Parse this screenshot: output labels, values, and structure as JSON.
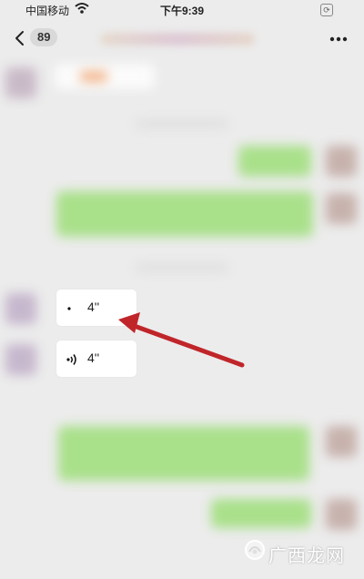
{
  "status_bar": {
    "carrier": "中国移动",
    "time": "下午9:39"
  },
  "nav": {
    "unread_count": "89"
  },
  "voice_messages": [
    {
      "duration": "4''",
      "icon": "voice-wave-icon-playing"
    },
    {
      "duration": "4''",
      "icon": "voice-wave-icon"
    }
  ],
  "annotation": {
    "color": "#c0252a"
  },
  "watermark": {
    "text": "广西龙网"
  },
  "colors": {
    "self_bubble": "#a9e08a",
    "other_bubble": "#ffffff",
    "background": "#ececec"
  }
}
